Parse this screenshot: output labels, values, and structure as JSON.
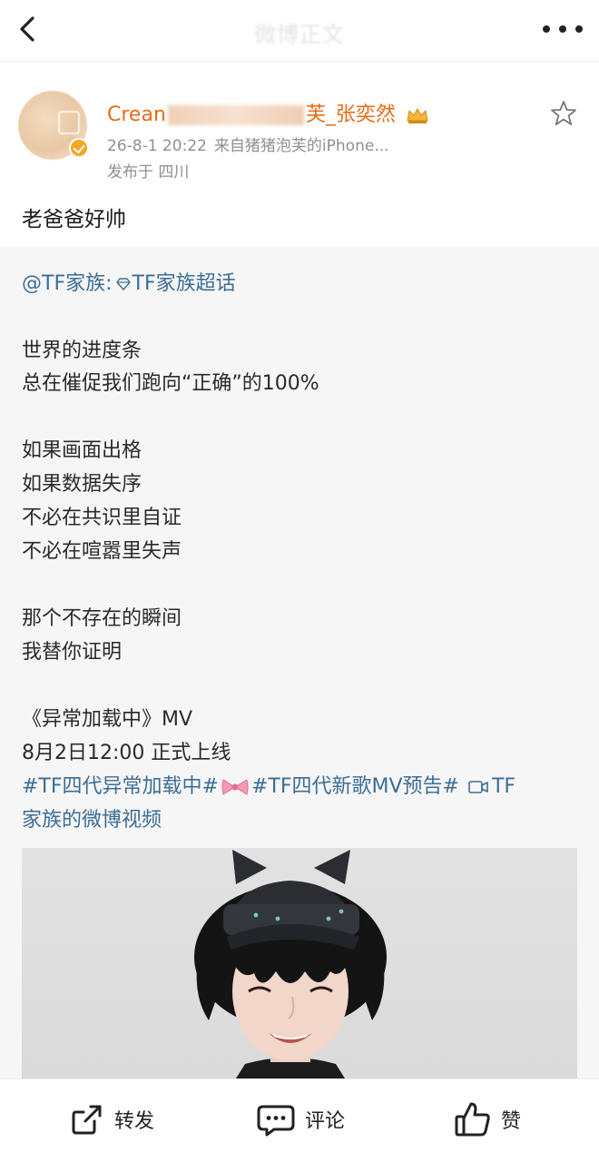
{
  "nav": {
    "title": "微博正文"
  },
  "post": {
    "username_start": "Crean",
    "username_end": "芙_张奕然",
    "timestamp": "26-8-1 20:22",
    "source": "来自猪猪泡芙的iPhone...",
    "location": "发布于 四川",
    "text": "老爸爸好帅"
  },
  "repost": {
    "mention": "@TF家族:",
    "supertopic": "TF家族超话",
    "lines": [
      "世界的进度条",
      "总在催促我们跑向“正确”的100%",
      "如果画面出格",
      "如果数据失序",
      "不必在共识里自证",
      "不必在喧嚣里失声",
      "那个不存在的瞬间",
      "我替你证明",
      "《异常加载中》MV",
      "8月2日12:00 正式上线"
    ],
    "hashtag1": "#TF四代异常加载中#",
    "hashtag2": "#TF四代新歌MV预告#",
    "video_link_1": "TF",
    "video_link_2": "家族的微博视频"
  },
  "actions": {
    "repost_label": "转发",
    "comment_label": "评论",
    "like_label": "赞"
  },
  "colors": {
    "username": "#e86b17",
    "link": "#3b6d96",
    "meta": "#8f8f8f"
  },
  "icons": [
    "back-icon",
    "more-icon",
    "star-icon",
    "verified-icon",
    "crown-icon",
    "diamond-icon",
    "bow-icon",
    "video-icon",
    "share-icon",
    "comment-icon",
    "like-icon"
  ]
}
